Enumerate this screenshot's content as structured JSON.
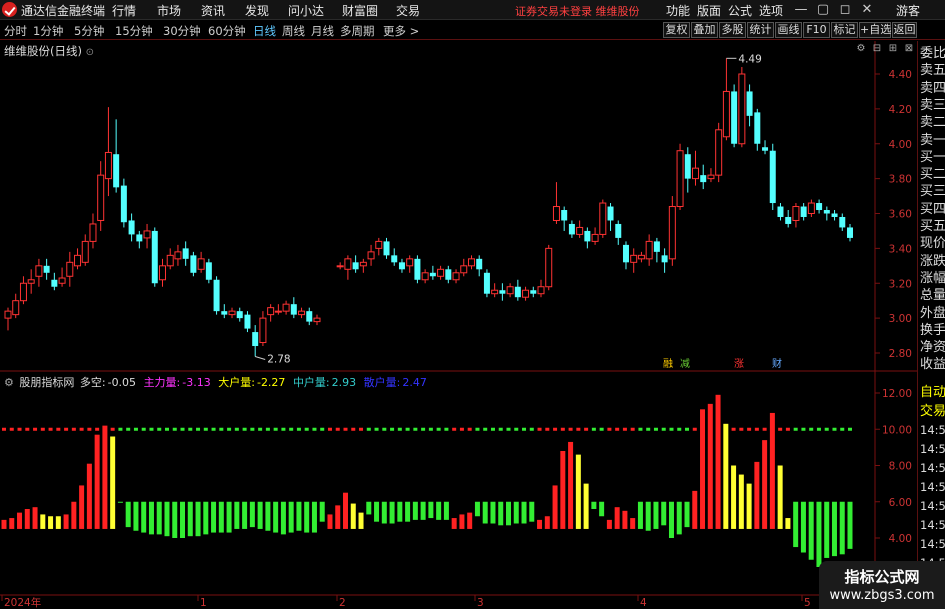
{
  "app": {
    "title": "通达信金融终端",
    "menu": [
      "行情",
      "市场",
      "资讯",
      "发现",
      "问小达",
      "财富圈",
      "交易"
    ],
    "notice": "证券交易未登录 维维股份",
    "right_menu": [
      "功能",
      "版面",
      "公式",
      "选项"
    ],
    "guest": "游客"
  },
  "toolbar": {
    "periods": [
      "分时",
      "1分钟",
      "5分钟",
      "15分钟",
      "30分钟",
      "60分钟",
      "日线",
      "周线",
      "月线",
      "多周期",
      "更多 >"
    ],
    "active_period": "日线",
    "buttons": [
      "复权",
      "叠加",
      "多股",
      "统计",
      "画线",
      "F10",
      "标记",
      "+自选",
      "返回"
    ]
  },
  "main_chart": {
    "title": "维维股份(日线)",
    "price_axis": [
      "4.40",
      "4.20",
      "4.00",
      "3.80",
      "3.60",
      "3.40",
      "3.20",
      "3.00",
      "2.80"
    ],
    "high_label": "4.49",
    "low_label": "2.78",
    "event_tags": [
      {
        "text": "融",
        "color": "#ffcc00"
      },
      {
        "text": "减",
        "color": "#66cc33"
      },
      {
        "text": "涨",
        "color": "#ff3333"
      },
      {
        "text": "财",
        "color": "#66aaff"
      }
    ],
    "up_color": "#ff3333",
    "down_color": "#54ffff"
  },
  "indicator": {
    "name": "股朋指标网",
    "items": [
      {
        "label": "多空:",
        "value": "-0.05",
        "color": "#dddddd"
      },
      {
        "label": "主力量:",
        "value": "-3.13",
        "color": "#ff33ff"
      },
      {
        "label": "大户量:",
        "value": "-2.27",
        "color": "#ffff00"
      },
      {
        "label": "中户量:",
        "value": "2.93",
        "color": "#33cccc"
      },
      {
        "label": "散户量:",
        "value": "2.47",
        "color": "#3333ff"
      }
    ],
    "axis": [
      "12.00",
      "10.00",
      "8.00",
      "6.00",
      "4.00"
    ],
    "baseline": 10.0,
    "colors": {
      "red": "#ff2222",
      "yellow": "#ffff33",
      "green": "#33ee33"
    }
  },
  "time_axis": [
    "2024年",
    "1",
    "2",
    "3",
    "4",
    "5"
  ],
  "right_panel": [
    "委比",
    "卖五",
    "卖四",
    "卖三",
    "卖二",
    "卖一",
    "买一",
    "买二",
    "买三",
    "买四",
    "买五",
    "现价",
    "涨跌",
    "涨幅",
    "总量",
    "外盘",
    "换手",
    "净资",
    "收益",
    "自动",
    "交易",
    "14:56",
    "14:56",
    "14:56",
    "14:56",
    "14:56",
    "14:56",
    "14:56",
    "14:56"
  ],
  "watermark": {
    "name": "指标公式网",
    "url": "www.zbgs3.com"
  }
}
